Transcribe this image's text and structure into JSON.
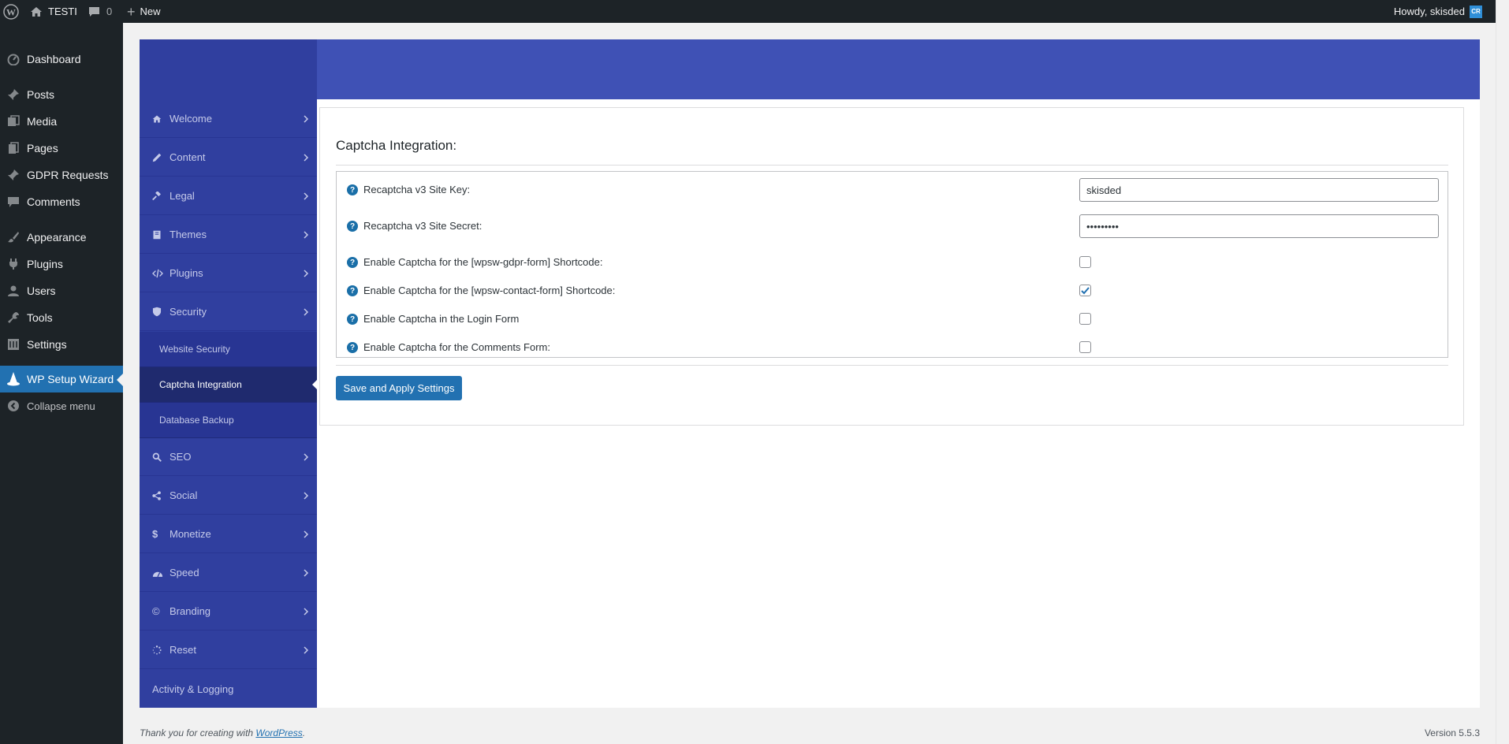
{
  "adminbar": {
    "site_name": "TESTI",
    "comments_count": "0",
    "new_label": "New",
    "howdy": "Howdy, skisded",
    "avatar_initials": "CR"
  },
  "admin_menu": {
    "items": [
      {
        "label": "Dashboard",
        "icon": "dashboard-icon"
      },
      {
        "label": "Posts",
        "icon": "pin-icon"
      },
      {
        "label": "Media",
        "icon": "media-icon"
      },
      {
        "label": "Pages",
        "icon": "pages-icon"
      },
      {
        "label": "GDPR Requests",
        "icon": "pin-icon"
      },
      {
        "label": "Comments",
        "icon": "comment-icon"
      },
      {
        "label": "Appearance",
        "icon": "brush-icon"
      },
      {
        "label": "Plugins",
        "icon": "plugin-icon"
      },
      {
        "label": "Users",
        "icon": "user-icon"
      },
      {
        "label": "Tools",
        "icon": "wrench-icon"
      },
      {
        "label": "Settings",
        "icon": "settings-icon"
      },
      {
        "label": "WP Setup Wizard",
        "icon": "wizard-hat-icon"
      }
    ],
    "collapse_label": "Collapse menu"
  },
  "wizard_menu": {
    "items": [
      {
        "label": "Welcome",
        "icon": "home-icon"
      },
      {
        "label": "Content",
        "icon": "pencil-icon"
      },
      {
        "label": "Legal",
        "icon": "gavel-icon"
      },
      {
        "label": "Themes",
        "icon": "book-icon"
      },
      {
        "label": "Plugins",
        "icon": "code-icon"
      },
      {
        "label": "Security",
        "icon": "shield-icon"
      }
    ],
    "sub_items": [
      {
        "label": "Website Security"
      },
      {
        "label": "Captcha Integration"
      },
      {
        "label": "Database Backup"
      }
    ],
    "items_after": [
      {
        "label": "SEO",
        "icon": "search-icon"
      },
      {
        "label": "Social",
        "icon": "share-icon"
      },
      {
        "label": "Monetize",
        "icon": "dollar-icon"
      },
      {
        "label": "Speed",
        "icon": "gauge-icon"
      },
      {
        "label": "Branding",
        "icon": "copyright-icon"
      },
      {
        "label": "Reset",
        "icon": "spinner-icon"
      },
      {
        "label": "Activity & Logging",
        "icon": ""
      }
    ]
  },
  "section": {
    "title": "Captcha Integration:",
    "rows": [
      {
        "label": "Recaptcha v3 Site Key:",
        "type": "text",
        "value": "skisded"
      },
      {
        "label": "Recaptcha v3 Site Secret:",
        "type": "password",
        "value": "•••••••••"
      },
      {
        "label": "Enable Captcha for the [wpsw-gdpr-form] Shortcode:",
        "type": "checkbox",
        "checked": false
      },
      {
        "label": "Enable Captcha for the [wpsw-contact-form] Shortcode:",
        "type": "checkbox",
        "checked": true
      },
      {
        "label": "Enable Captcha in the Login Form",
        "type": "checkbox",
        "checked": false
      },
      {
        "label": "Enable Captcha for the Comments Form:",
        "type": "checkbox",
        "checked": false
      }
    ],
    "save_label": "Save and Apply Settings"
  },
  "footer": {
    "thanks_prefix": "Thank you for creating with ",
    "thanks_link": "WordPress",
    "thanks_suffix": ".",
    "version": "Version 5.5.3"
  },
  "colors": {
    "admin_dark": "#1d2327",
    "wp_blue": "#2271b1",
    "wizard_header": "#3f51b5",
    "wizard_sidebar": "#303f9f"
  }
}
